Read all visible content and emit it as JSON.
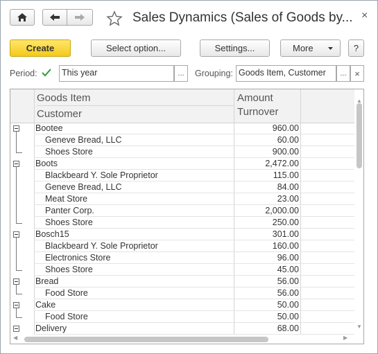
{
  "window": {
    "title": "Sales Dynamics (Sales of Goods by...",
    "close_glyph": "×"
  },
  "toolbar": {
    "create_label": "Create",
    "select_option_label": "Select option...",
    "settings_label": "Settings...",
    "more_label": "More",
    "help_label": "?"
  },
  "filters": {
    "period_label": "Period:",
    "period_checked": true,
    "period_value": "This year",
    "grouping_label": "Grouping:",
    "grouping_value": "Goods Item, Customer",
    "select_glyph": "...",
    "clear_glyph": "×"
  },
  "table": {
    "header": {
      "col1_line1": "Goods Item",
      "col1_line2": "Customer",
      "col2_line1": "Amount",
      "col2_line2": "Turnover"
    },
    "rows": [
      {
        "name": "Bootee",
        "amount": "960.00",
        "level": 0
      },
      {
        "name": "Geneve Bread, LLC",
        "amount": "60.00",
        "level": 1
      },
      {
        "name": "Shoes Store",
        "amount": "900.00",
        "level": 1
      },
      {
        "name": "Boots",
        "amount": "2,472.00",
        "level": 0
      },
      {
        "name": "Blackbeard Y. Sole Proprietor",
        "amount": "115.00",
        "level": 1
      },
      {
        "name": "Geneve Bread, LLC",
        "amount": "84.00",
        "level": 1
      },
      {
        "name": "Meat Store",
        "amount": "23.00",
        "level": 1
      },
      {
        "name": "Panter Corp.",
        "amount": "2,000.00",
        "level": 1
      },
      {
        "name": "Shoes Store",
        "amount": "250.00",
        "level": 1
      },
      {
        "name": "Bosch15",
        "amount": "301.00",
        "level": 0
      },
      {
        "name": "Blackbeard Y. Sole Proprietor",
        "amount": "160.00",
        "level": 1
      },
      {
        "name": "Electronics Store",
        "amount": "96.00",
        "level": 1
      },
      {
        "name": "Shoes Store",
        "amount": "45.00",
        "level": 1
      },
      {
        "name": "Bread",
        "amount": "56.00",
        "level": 0
      },
      {
        "name": "Food Store",
        "amount": "56.00",
        "level": 1
      },
      {
        "name": "Cake",
        "amount": "50.00",
        "level": 0
      },
      {
        "name": "Food Store",
        "amount": "50.00",
        "level": 1
      },
      {
        "name": "Delivery",
        "amount": "68.00",
        "level": 0
      }
    ]
  }
}
